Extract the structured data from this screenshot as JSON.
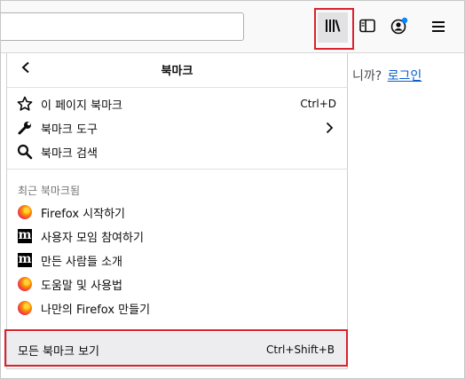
{
  "page": {
    "login_prompt": "니까?",
    "login_link": "로그인"
  },
  "toolbar": {
    "library_icon": "library-icon",
    "sidebar_icon": "sidebar-icon",
    "account_icon": "account-icon",
    "menu_icon": "hamburger-menu-icon",
    "highlight_color": "#d9232d"
  },
  "panel": {
    "title": "북마크",
    "items": [
      {
        "label": "이 페이지 북마크",
        "shortcut": "Ctrl+D",
        "icon": "star-icon"
      },
      {
        "label": "북마크 도구",
        "icon": "wrench-icon",
        "submenu": true
      },
      {
        "label": "북마크 검색",
        "icon": "search-icon"
      }
    ],
    "recent_header": "최근 북마크됨",
    "recent": [
      {
        "label": "Firefox 시작하기",
        "icon": "firefox-icon"
      },
      {
        "label": "사용자 모임 참여하기",
        "icon": "mozilla-m-icon"
      },
      {
        "label": "만든 사람들 소개",
        "icon": "mozilla-m-icon"
      },
      {
        "label": "도움말 및 사용법",
        "icon": "firefox-icon"
      },
      {
        "label": "나만의 Firefox 만들기",
        "icon": "firefox-icon"
      }
    ],
    "footer": {
      "label": "모든 북마크 보기",
      "shortcut": "Ctrl+Shift+B"
    }
  }
}
